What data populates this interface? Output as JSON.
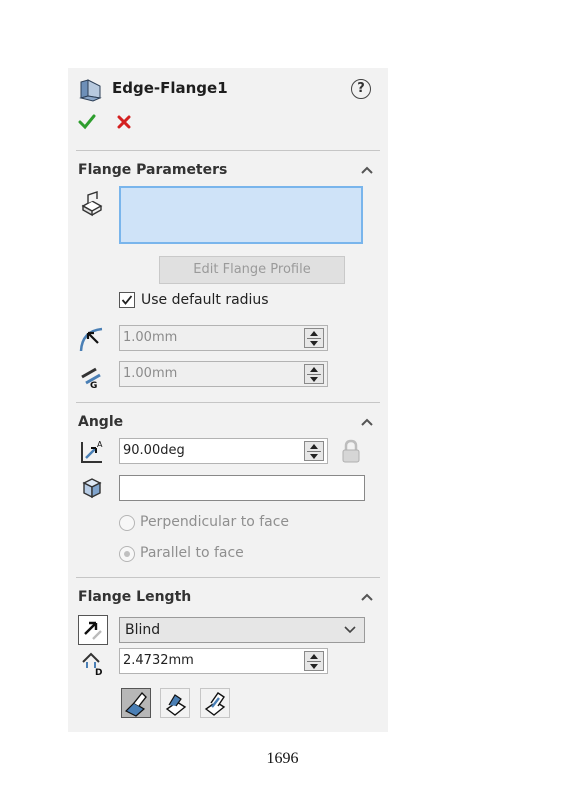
{
  "header": {
    "title": "Edge-Flange1"
  },
  "icons": {
    "title": "edge-flange-icon",
    "help": "help-icon",
    "ok": "checkmark-icon",
    "cancel": "close-icon",
    "help_glyph": "?"
  },
  "sections": {
    "flange_parameters": {
      "title": "Flange Parameters",
      "edit_profile_label": "Edit Flange Profile",
      "use_default_radius_label": "Use default radius",
      "use_default_radius_checked": true,
      "bend_radius_value": "1.00mm",
      "gap_distance_value": "1.00mm"
    },
    "angle": {
      "title": "Angle",
      "angle_value": "90.00deg",
      "face_value": "",
      "option_perpendicular": "Perpendicular to face",
      "option_parallel": "Parallel to face",
      "selected_option": "Parallel to face"
    },
    "flange_length": {
      "title": "Flange Length",
      "end_condition": "Blind",
      "length_value": "2.4732mm",
      "length_icon_letter": "D"
    }
  },
  "gap_icon_letter": "G",
  "page_number": "1696",
  "colors": {
    "selection_fill": "#cfe3f8",
    "selection_border": "#79b5ec",
    "ok": "#2e9e2e",
    "cancel": "#d42020"
  }
}
